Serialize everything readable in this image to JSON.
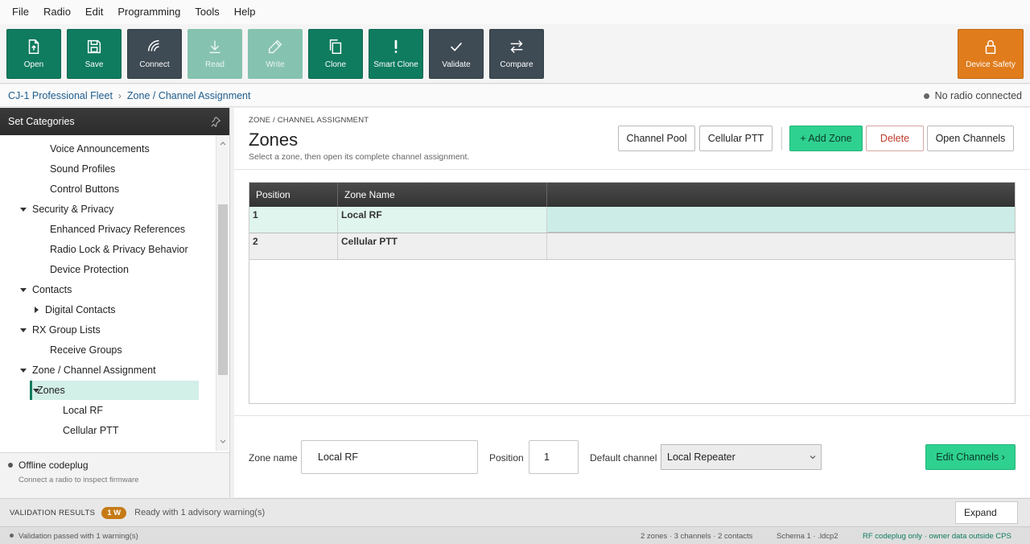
{
  "menu": [
    "File",
    "Radio",
    "Edit",
    "Programming",
    "Tools",
    "Help"
  ],
  "toolbar": {
    "open": "Open",
    "save": "Save",
    "connect": "Connect",
    "read": "Read",
    "write": "Write",
    "clone": "Clone",
    "smart_clone": "Smart Clone",
    "validate": "Validate",
    "compare": "Compare",
    "device_safety": "Device Safety"
  },
  "breadcrumb": {
    "root": "CJ-1 Professional Fleet",
    "sep": "›",
    "current": "Zone / Channel Assignment",
    "connection": "No radio connected"
  },
  "sidebar": {
    "title": "Set Categories",
    "items": [
      {
        "label": "Voice Announcements"
      },
      {
        "label": "Sound Profiles"
      },
      {
        "label": "Control Buttons"
      },
      {
        "label": "Security & Privacy"
      },
      {
        "label": "Enhanced Privacy References"
      },
      {
        "label": "Radio Lock & Privacy Behavior"
      },
      {
        "label": "Device Protection"
      },
      {
        "label": "Contacts"
      },
      {
        "label": "Digital Contacts"
      },
      {
        "label": "RX Group Lists"
      },
      {
        "label": "Receive Groups"
      },
      {
        "label": "Zone / Channel Assignment"
      },
      {
        "label": "Zones"
      },
      {
        "label": "Local RF"
      },
      {
        "label": "Cellular PTT"
      }
    ],
    "offline_title": "Offline codeplug",
    "offline_sub": "Connect a radio to inspect firmware"
  },
  "main": {
    "section": "ZONE / CHANNEL ASSIGNMENT",
    "title": "Zones",
    "subtitle": "Select a zone, then open its complete channel assignment.",
    "buttons": {
      "channel_pool": "Channel Pool",
      "cellular_ptt": "Cellular PTT",
      "add_zone": "+ Add Zone",
      "delete": "Delete",
      "open_channels": "Open Channels"
    },
    "table": {
      "headers": [
        "Position",
        "Zone Name",
        ""
      ],
      "rows": [
        {
          "position": "1",
          "name": "Local RF"
        },
        {
          "position": "2",
          "name": "Cellular PTT"
        }
      ]
    },
    "form": {
      "zone_name_label": "Zone name",
      "zone_name_value": "Local RF",
      "position_label": "Position",
      "position_value": "1",
      "default_channel_label": "Default channel",
      "default_channel_value": "Local Repeater",
      "edit_channels": "Edit Channels ›"
    }
  },
  "validation": {
    "label": "VALIDATION RESULTS",
    "badge": "1 W",
    "message": "Ready with 1 advisory warning(s)",
    "expand": "Expand"
  },
  "status": {
    "left": "Validation passed with 1 warning(s)",
    "counts": "2 zones · 3 channels · 2 contacts",
    "schema": "Schema 1 · .ldcp2",
    "scope": "RF codeplug only · owner data outside CPS"
  },
  "colors": {
    "primary_green": "#0f7b5f",
    "accent_green": "#2fd190",
    "slate": "#3e4a54",
    "orange": "#e07c1c",
    "danger": "#c0392b",
    "link_blue": "#1e5c8c"
  }
}
